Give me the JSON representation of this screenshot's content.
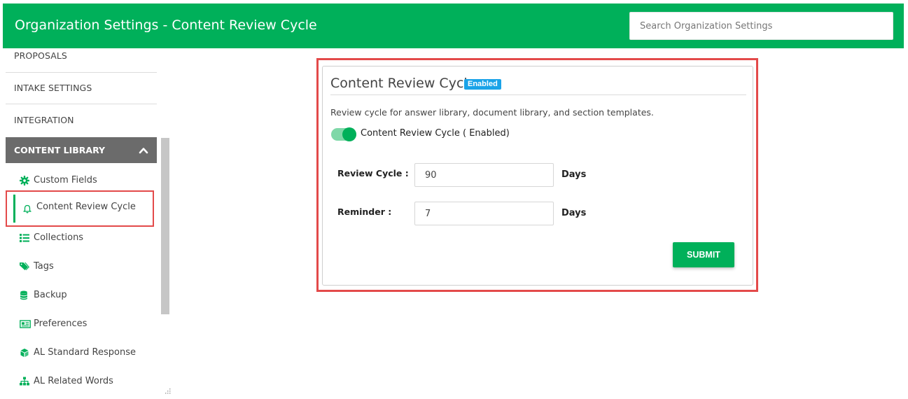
{
  "header": {
    "title": "Organization Settings - Content Review Cycle",
    "search_placeholder": "Search Organization Settings"
  },
  "sidebar": {
    "items": [
      {
        "label": "PROPOSALS"
      },
      {
        "label": "INTAKE SETTINGS"
      },
      {
        "label": "INTEGRATION"
      }
    ],
    "section": {
      "label": "CONTENT LIBRARY",
      "icon": "chevron-up-icon"
    },
    "subitems": [
      {
        "label": "Custom Fields",
        "icon": "gear-icon"
      },
      {
        "label": "Content Review Cycle",
        "icon": "bell-icon",
        "active": true
      },
      {
        "label": "Collections",
        "icon": "list-icon"
      },
      {
        "label": "Tags",
        "icon": "tags-icon"
      },
      {
        "label": "Backup",
        "icon": "database-icon"
      },
      {
        "label": "Preferences",
        "icon": "newspaper-icon"
      },
      {
        "label": "AL Standard Response",
        "icon": "cube-icon"
      },
      {
        "label": "AL Related Words",
        "icon": "sitemap-icon"
      }
    ]
  },
  "panel": {
    "title": "Content Review Cycle",
    "badge": "Enabled",
    "description": "Review cycle for answer library, document library, and section templates.",
    "toggle_label": "Content Review Cycle ( Enabled)",
    "toggle_on": true,
    "review_cycle": {
      "label": "Review Cycle :",
      "value": "90",
      "unit": "Days"
    },
    "reminder": {
      "label": "Reminder :",
      "value": "7",
      "unit": "Days"
    },
    "submit_label": "SUBMIT"
  },
  "colors": {
    "brand": "#00b05a",
    "badge": "#1aa3e8",
    "highlight": "#e34a4a",
    "section_head": "#6b6b6b"
  }
}
